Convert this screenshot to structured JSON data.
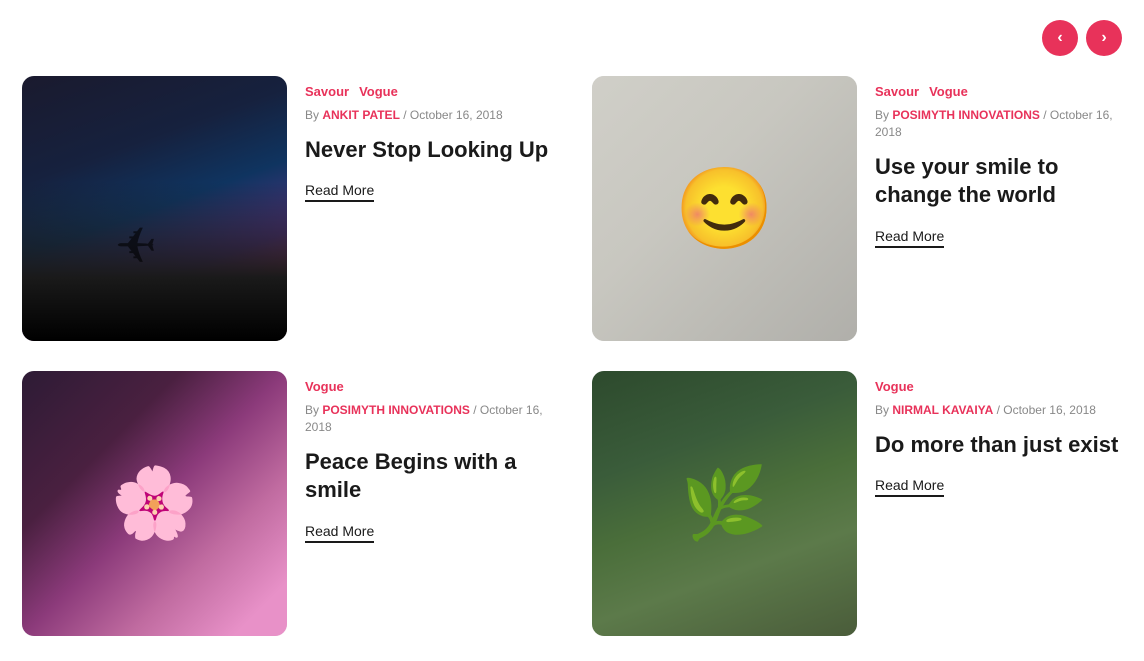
{
  "nav": {
    "prev_label": "‹",
    "next_label": "›"
  },
  "cards": [
    {
      "id": "card-1",
      "tags": [
        "Savour",
        "Vogue"
      ],
      "author": "ANKIT PATEL",
      "date": "October 16, 2018",
      "title": "Never Stop Looking Up",
      "read_more": "Read More",
      "image_class": "img-dark-forest"
    },
    {
      "id": "card-2",
      "tags": [
        "Savour",
        "Vogue"
      ],
      "author": "POSIMYTH INNOVATIONS",
      "date": "October 16, 2018",
      "title": "Use your smile to change the world",
      "read_more": "Read More",
      "image_class": "img-smiling-woman"
    },
    {
      "id": "card-3",
      "tags": [
        "Vogue"
      ],
      "author": "POSIMYTH INNOVATIONS",
      "date": "October 16, 2018",
      "title": "Peace Begins with a smile",
      "read_more": "Read More",
      "image_class": "img-flower-woman"
    },
    {
      "id": "card-4",
      "tags": [
        "Vogue"
      ],
      "author": "NIRMAL KAVAIYA",
      "date": "October 16, 2018",
      "title": "Do more than just exist",
      "read_more": "Read More",
      "image_class": "img-swing-forest"
    }
  ]
}
